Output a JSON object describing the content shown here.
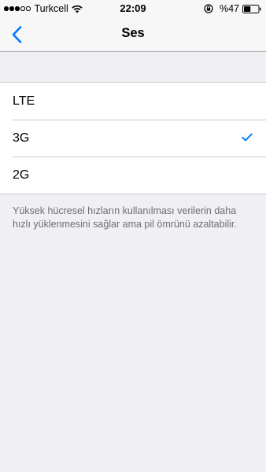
{
  "status_bar": {
    "carrier": "Turkcell",
    "time": "22:09",
    "battery_percent": "%47",
    "battery_level": 0.47,
    "signal_bars_filled": 3,
    "signal_bars_total": 5
  },
  "nav": {
    "title": "Ses",
    "back_icon": "chevron-left-icon"
  },
  "options": [
    {
      "label": "LTE",
      "selected": false
    },
    {
      "label": "3G",
      "selected": true
    },
    {
      "label": "2G",
      "selected": false
    }
  ],
  "footer_note": "Yüksek hücresel hızların kullanılması verilerin daha hızlı yüklenmesini sağlar ama pil ömrünü azaltabilir.",
  "colors": {
    "accent": "#007aff",
    "background": "#efeff4",
    "separator": "#c8c7cc",
    "footer_text": "#6d6d72"
  }
}
